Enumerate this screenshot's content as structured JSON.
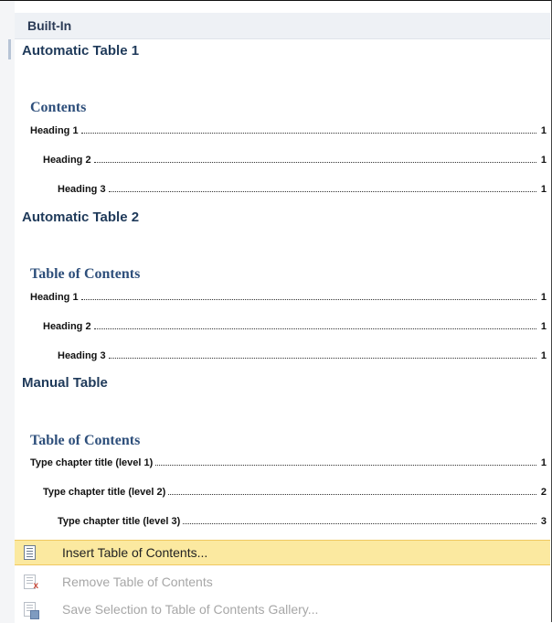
{
  "gallery": {
    "section_header": "Built-In",
    "items": [
      {
        "title": "Automatic Table 1",
        "toc_heading": "Contents",
        "entries": [
          {
            "label": "Heading 1",
            "page": "1"
          },
          {
            "label": "Heading 2",
            "page": "1"
          },
          {
            "label": "Heading 3",
            "page": "1"
          }
        ]
      },
      {
        "title": "Automatic Table 2",
        "toc_heading": "Table of Contents",
        "entries": [
          {
            "label": "Heading 1",
            "page": "1"
          },
          {
            "label": "Heading 2",
            "page": "1"
          },
          {
            "label": "Heading 3",
            "page": "1"
          }
        ]
      },
      {
        "title": "Manual Table",
        "toc_heading": "Table of Contents",
        "entries": [
          {
            "label": "Type chapter title (level 1)",
            "page": "1"
          },
          {
            "label": "Type chapter title (level 2)",
            "page": "2"
          },
          {
            "label": "Type chapter title (level 3)",
            "page": "3"
          }
        ]
      }
    ]
  },
  "commands": [
    {
      "label": "Insert Table of Contents...",
      "icon": "insert-toc-icon",
      "state": "highlighted"
    },
    {
      "label": "Remove Table of Contents",
      "icon": "remove-toc-icon",
      "state": "disabled"
    },
    {
      "label": "Save Selection to Table of Contents Gallery...",
      "icon": "save-selection-icon",
      "state": "disabled"
    }
  ],
  "colors": {
    "highlight": "#fbe9a0",
    "toc_heading": "#2e4f7b",
    "disabled_text": "#a7a7a7"
  }
}
